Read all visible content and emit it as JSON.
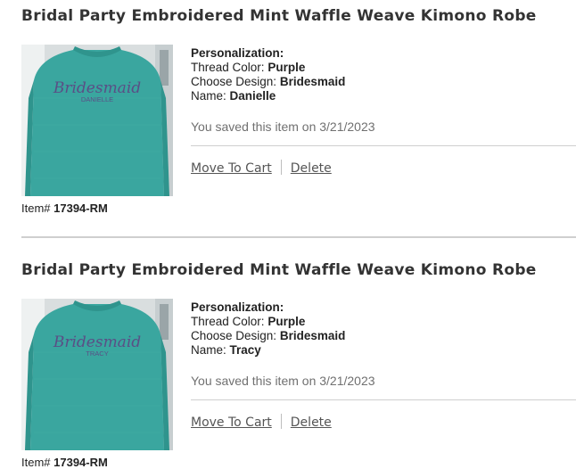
{
  "items": [
    {
      "title": "Bridal Party Embroidered Mint Waffle Weave Kimono Robe",
      "image": {
        "embroidery_script": "Bridesmaid",
        "embroidery_name": "DANIELLE"
      },
      "item_label": "Item#",
      "item_number": "17394-RM",
      "personalization_heading": "Personalization:",
      "thread_color_label": "Thread Color:",
      "thread_color_value": "Purple",
      "design_label": "Choose Design:",
      "design_value": "Bridesmaid",
      "name_label": "Name:",
      "name_value": "Danielle",
      "saved_text": "You saved this item on 3/21/2023",
      "move_to_cart": "Move To Cart",
      "delete": "Delete"
    },
    {
      "title": "Bridal Party Embroidered Mint Waffle Weave Kimono Robe",
      "image": {
        "embroidery_script": "Bridesmaid",
        "embroidery_name": "TRACY"
      },
      "item_label": "Item#",
      "item_number": "17394-RM",
      "personalization_heading": "Personalization:",
      "thread_color_label": "Thread Color:",
      "thread_color_value": "Purple",
      "design_label": "Choose Design:",
      "design_value": "Bridesmaid",
      "name_label": "Name:",
      "name_value": "Tracy",
      "saved_text": "You saved this item on 3/21/2023",
      "move_to_cart": "Move To Cart",
      "delete": "Delete"
    }
  ],
  "colors": {
    "robe": "#3aa69f",
    "embroidery": "#5a4f86",
    "title_text": "#333333",
    "muted_text": "#707070",
    "rule": "#cfcfcf"
  }
}
